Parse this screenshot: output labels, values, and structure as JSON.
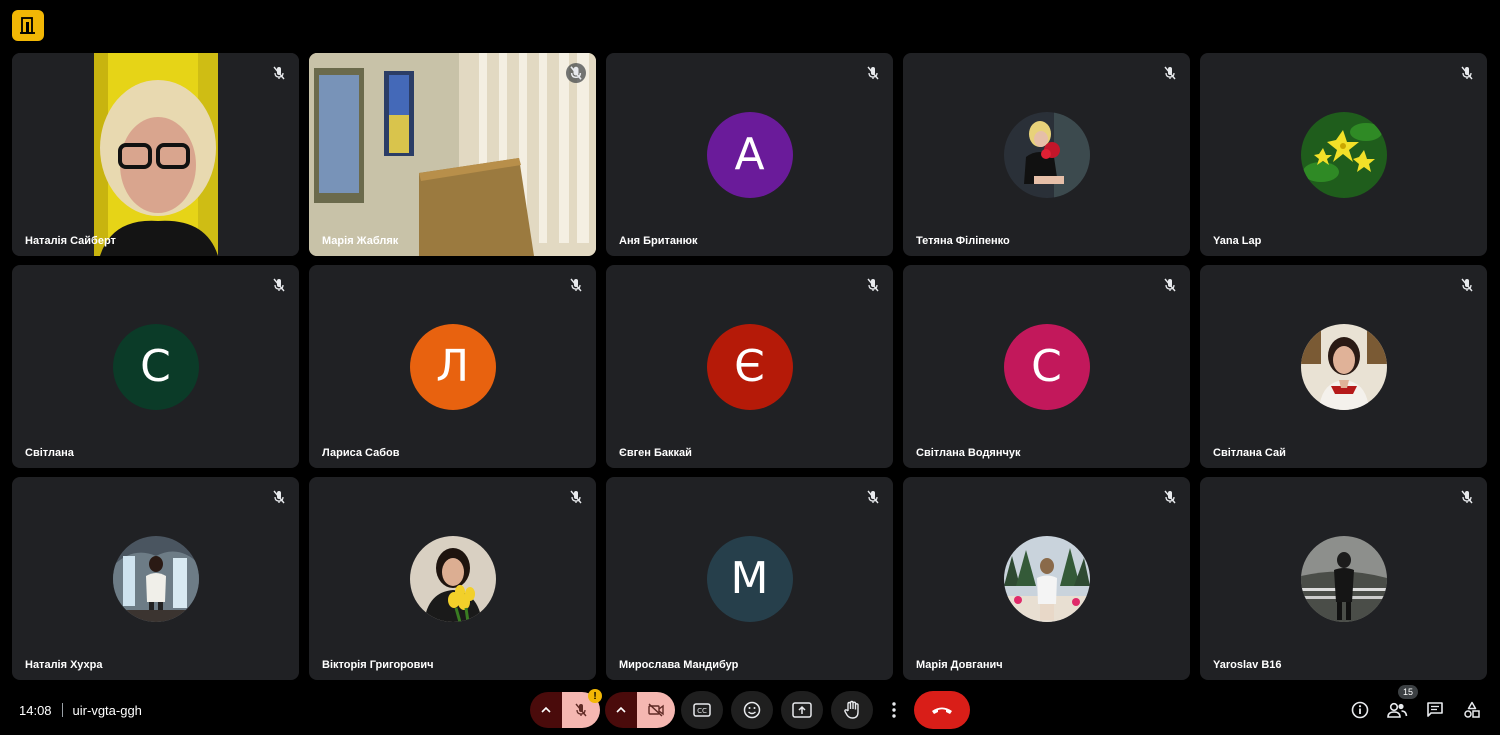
{
  "participants": [
    {
      "name": "Наталія Сайберт",
      "type": "video"
    },
    {
      "name": "Марія Жабляк",
      "type": "video"
    },
    {
      "name": "Аня Британюк",
      "type": "initial",
      "initial": "А",
      "color": "#6a1b9a"
    },
    {
      "name": "Тетяна Філіпенко",
      "type": "photo"
    },
    {
      "name": "Yana Lap",
      "type": "photo"
    },
    {
      "name": "Світлана",
      "type": "initial",
      "initial": "С",
      "color": "#0b3b28"
    },
    {
      "name": "Лариса Сабов",
      "type": "initial",
      "initial": "Л",
      "color": "#e8620f"
    },
    {
      "name": "Євген Баккай",
      "type": "initial",
      "initial": "Є",
      "color": "#b51a08"
    },
    {
      "name": "Світлана Водянчук",
      "type": "initial",
      "initial": "С",
      "color": "#c2185b"
    },
    {
      "name": "Світлана Сай",
      "type": "photo"
    },
    {
      "name": "Наталія Хухра",
      "type": "photo"
    },
    {
      "name": "Вікторія Григорович",
      "type": "photo"
    },
    {
      "name": "Мирослава Мандибур",
      "type": "initial",
      "initial": "М",
      "color": "#263f4b"
    },
    {
      "name": "Марія Довганич",
      "type": "photo"
    },
    {
      "name": "Yaroslav B16",
      "type": "photo"
    }
  ],
  "meeting": {
    "time": "14:08",
    "code": "uir-vgta-ggh"
  },
  "people_count": "15",
  "warning_mark": "!",
  "colors": {
    "end_call": "#d91e18",
    "muted_control": "#f5b7b1",
    "logo": "#f2b705",
    "tile": "#202124"
  }
}
